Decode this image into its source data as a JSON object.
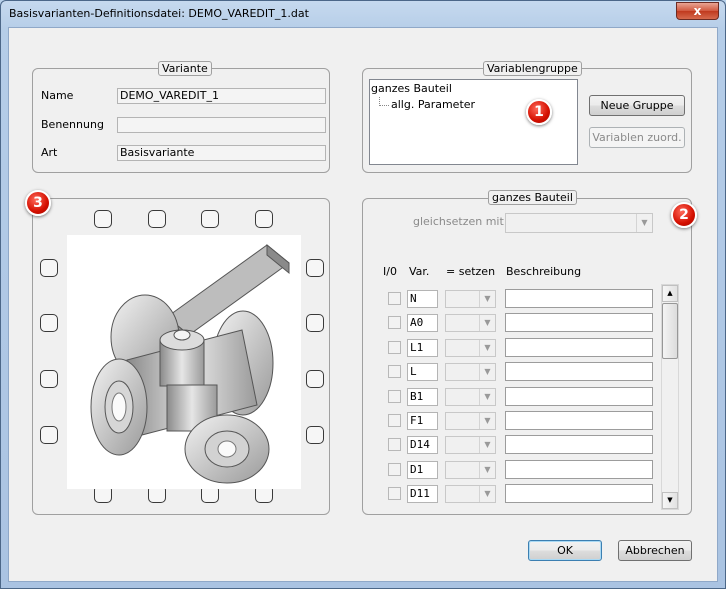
{
  "window": {
    "title": "Basisvarianten-Definitionsdatei:  DEMO_VAREDIT_1.dat",
    "close_glyph": "x"
  },
  "variante": {
    "legend": "Variante",
    "name_label": "Name",
    "name_value": "DEMO_VAREDIT_1",
    "benennung_label": "Benennung",
    "benennung_value": "",
    "art_label": "Art",
    "art_value": "Basisvariante"
  },
  "variablengruppe": {
    "legend": "Variablengruppe",
    "tree_root": "ganzes Bauteil",
    "tree_child": "allg. Parameter",
    "neue_gruppe": "Neue Gruppe",
    "variablen_zuord": "Variablen zuord."
  },
  "badges": [
    "1",
    "2",
    "3"
  ],
  "bauteil": {
    "legend": "ganzes Bauteil",
    "gleichsetzen_label": "gleichsetzen mit",
    "col_io": "I/0",
    "col_var": "Var.",
    "col_setzen": "= setzen",
    "col_desc": "Beschreibung",
    "rows": [
      "N",
      "A0",
      "L1",
      "L",
      "B1",
      "F1",
      "D14",
      "D1",
      "D11"
    ]
  },
  "buttons": {
    "ok": "OK",
    "cancel": "Abbrechen"
  },
  "colors": {
    "badge_red": "#d40f00",
    "frame_blue": "#b5cde8"
  }
}
